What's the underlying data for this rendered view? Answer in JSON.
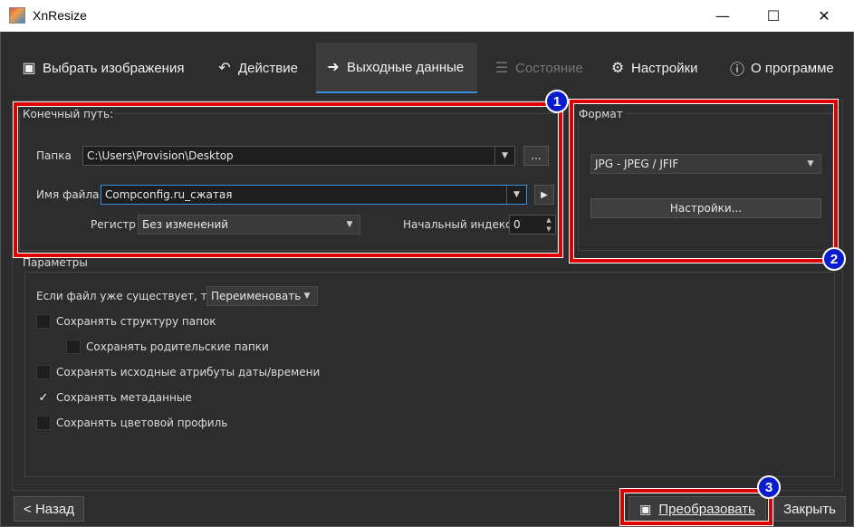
{
  "window": {
    "title": "XnResize"
  },
  "titlebar": {
    "minimize_icon": "minimize-icon",
    "maximize_icon": "maximize-icon",
    "close_icon": "close-icon"
  },
  "tabs": [
    {
      "label": "Выбрать изображения",
      "icon": "image-select-icon",
      "state": "normal"
    },
    {
      "label": "Действие",
      "icon": "undo-action-icon",
      "state": "normal"
    },
    {
      "label": "Выходные данные",
      "icon": "output-arrow-icon",
      "state": "active"
    },
    {
      "label": "Состояние",
      "icon": "clipboard-list-icon",
      "state": "disabled"
    },
    {
      "label": "Настройки",
      "icon": "gear-icon",
      "state": "normal"
    },
    {
      "label": "О программе",
      "icon": "info-icon",
      "state": "normal"
    }
  ],
  "destination": {
    "title": "Конечный путь:",
    "folder_label": "Папка",
    "folder_value": "C:\\Users\\Provision\\Desktop",
    "browse_label": "...",
    "filename_label": "Имя файла",
    "filename_value": "Compconfig.ru_сжатая",
    "case_label": "Регистр",
    "case_value": "Без изменений",
    "start_index_label": "Начальный индекс",
    "start_index_value": "0"
  },
  "format": {
    "title": "Формат",
    "value": "JPG - JPEG / JFIF",
    "settings_button": "Настройки..."
  },
  "parameters": {
    "title": "Параметры",
    "if_exists_label": "Если файл уже существует, то",
    "if_exists_value": "Переименовать",
    "options": [
      {
        "label": "Сохранять структуру папок",
        "checked": false
      },
      {
        "label": "Сохранять родительские папки",
        "checked": false
      },
      {
        "label": "Сохранять исходные атрибуты даты/времени",
        "checked": false
      },
      {
        "label": "Сохранять метаданные",
        "checked": true
      },
      {
        "label": "Сохранять цветовой профиль",
        "checked": false
      }
    ]
  },
  "footer": {
    "back_button": "< Назад",
    "convert_button": "Преобразовать",
    "close_button": "Закрыть"
  },
  "annotations": {
    "badge1": "1",
    "badge2": "2",
    "badge3": "3"
  },
  "colors": {
    "highlight": "#e00000",
    "badge": "#0b1ccf",
    "accent": "#3a8de0",
    "background": "#2d2d2d"
  }
}
